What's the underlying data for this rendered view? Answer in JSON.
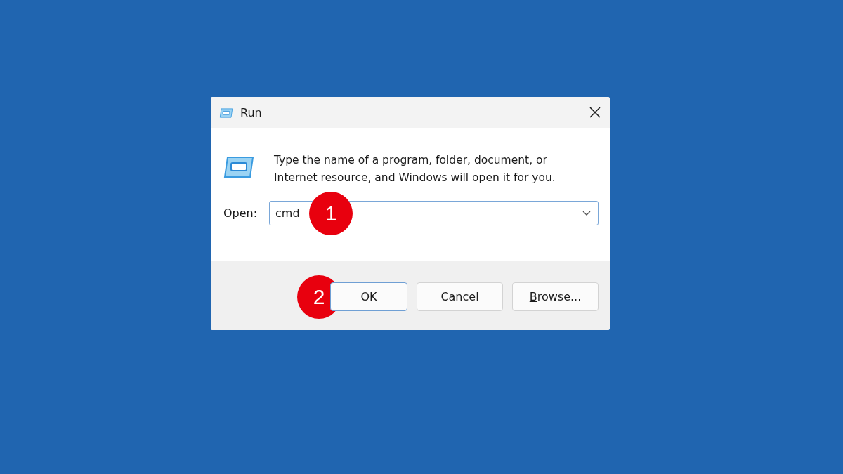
{
  "window": {
    "title": "Run"
  },
  "description": "Type the name of a program, folder, document, or Internet resource, and Windows will open it for you.",
  "open_field": {
    "label": "Open:",
    "label_underline_first": true,
    "value": "cmd",
    "focused": true,
    "badge": "1"
  },
  "buttons": [
    {
      "label": "OK",
      "default": true,
      "underline_first": false,
      "badge": "2"
    },
    {
      "label": "Cancel",
      "default": false,
      "underline_first": false
    },
    {
      "label": "Browse...",
      "default": false,
      "underline_first": true
    }
  ]
}
